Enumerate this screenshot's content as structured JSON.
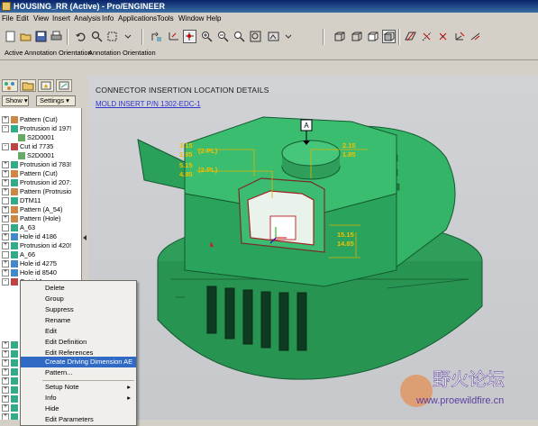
{
  "window": {
    "title": "HOUSING_RR (Active) - Pro/ENGINEER"
  },
  "menu": [
    "File",
    "Edit",
    "View",
    "Insert",
    "Analysis",
    "Info",
    "Applications",
    "Tools",
    "Window",
    "Help"
  ],
  "toolbar": {
    "icons": [
      "new-icon",
      "open-icon",
      "save-icon",
      "print-icon",
      "undo-icon",
      "search-icon",
      "select-box-icon",
      "repaint-icon",
      "orient-icon",
      "spin-center-icon",
      "zoom-in-icon",
      "zoom-out-icon",
      "refit-icon",
      "saved-views-icon",
      "wireframe-icon",
      "hidden-line-icon",
      "no-hidden-icon",
      "shaded-icon",
      "datum-planes-icon",
      "datum-axes-icon",
      "datum-points-icon",
      "coord-sys-icon"
    ],
    "labels": [
      "Active Annotation Orientation",
      "Annotation Orientation"
    ]
  },
  "left_panel": {
    "dropdowns": [
      "Show ▾",
      "Settings ▾"
    ],
    "tree": [
      {
        "label": "Pattern (Cut)",
        "exp": "+"
      },
      {
        "label": "Protrusion id 197!",
        "exp": "-"
      },
      {
        "label": "S2D0001",
        "child": true
      },
      {
        "label": "Cut id 7735",
        "exp": "-"
      },
      {
        "label": "S2D0001",
        "child": true
      },
      {
        "label": "Protrusion id 783!",
        "exp": "+"
      },
      {
        "label": "Pattern (Cut)",
        "exp": "+"
      },
      {
        "label": "Protrusion id 207:",
        "exp": "+"
      },
      {
        "label": "Pattern (Protrusio",
        "exp": "+"
      },
      {
        "label": "DTM11",
        "exp": ""
      },
      {
        "label": "Pattern (A_54)",
        "exp": "+"
      },
      {
        "label": "Pattern (Hole)",
        "exp": "+"
      },
      {
        "label": "A_63",
        "exp": ""
      },
      {
        "label": "Hole id 4186",
        "exp": "+"
      },
      {
        "label": "Protrusion id 420!",
        "exp": "+"
      },
      {
        "label": "A_66",
        "exp": ""
      },
      {
        "label": "Hole id 4275",
        "exp": "+"
      },
      {
        "label": "Hole id 8540",
        "exp": "+"
      },
      {
        "label": "Cut id 1",
        "exp": "-"
      }
    ],
    "tree_tail": [
      "Rou",
      "Rou",
      "Hol",
      "Hol",
      "Hol",
      "Rou",
      "A",
      "B",
      "Ann"
    ]
  },
  "viewport": {
    "title": "CONNECTOR INSERTION LOCATION DETAILS",
    "subtitle": "MOLD INSERT P/N  1302-EDC-1",
    "datum_tag": "A",
    "dims": [
      "3.15",
      "1.85",
      "(2-PL)",
      "5.15",
      "4.85",
      "(2-PL)",
      "2.15",
      "1.85",
      "15.15",
      "14.85"
    ]
  },
  "context_menu": {
    "items": [
      "Delete",
      "Group",
      "Suppress",
      "Rename",
      "Edit",
      "Edit Definition",
      "Edit References",
      "Create Driving Dimension AE",
      "Pattern...",
      "Setup Note",
      "Info",
      "Hide",
      "Edit Parameters"
    ],
    "selected": "Create Driving Dimension AE"
  },
  "watermark": {
    "text": "野火论坛",
    "url": "www.proewildfire.cn"
  },
  "colors": {
    "part": "#2fa85f",
    "title_bar": "#0a246a",
    "selection": "#316ac5",
    "dims": "#e0b000"
  }
}
